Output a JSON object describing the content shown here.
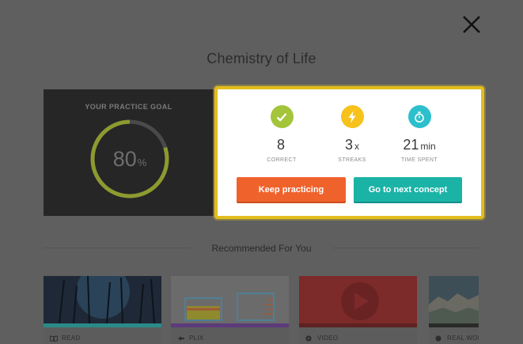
{
  "page": {
    "title": "Chemistry of Life",
    "close_icon": "close-icon"
  },
  "goal": {
    "heading": "YOUR PRACTICE GOAL",
    "value": "80",
    "unit": "%",
    "progress": 0.8
  },
  "stats": [
    {
      "icon": "check-icon",
      "color": "#a4c43a",
      "value": "8",
      "unit": "",
      "label": "CORRECT"
    },
    {
      "icon": "lightning-icon",
      "color": "#f6c21b",
      "value": "3",
      "unit": "x",
      "label": "STREAKS"
    },
    {
      "icon": "stopwatch-icon",
      "color": "#2cc0cc",
      "value": "21",
      "unit": "min",
      "label": "TIME SPENT"
    }
  ],
  "actions": {
    "keep_label": "Keep practicing",
    "next_label": "Go to next concept"
  },
  "recommended": {
    "title": "Recommended For You",
    "cards": [
      {
        "type": "READ",
        "icon": "book-icon"
      },
      {
        "type": "PLIX",
        "icon": "plix-icon"
      },
      {
        "type": "VIDEO",
        "icon": "play-circle-icon"
      },
      {
        "type": "REAL WOR",
        "icon": "globe-icon"
      }
    ]
  },
  "colors": {
    "highlight": "#e2bd1d",
    "keep_button": "#f0622c",
    "next_button": "#1bb3a6",
    "goal_ring": "#a4c43a"
  }
}
